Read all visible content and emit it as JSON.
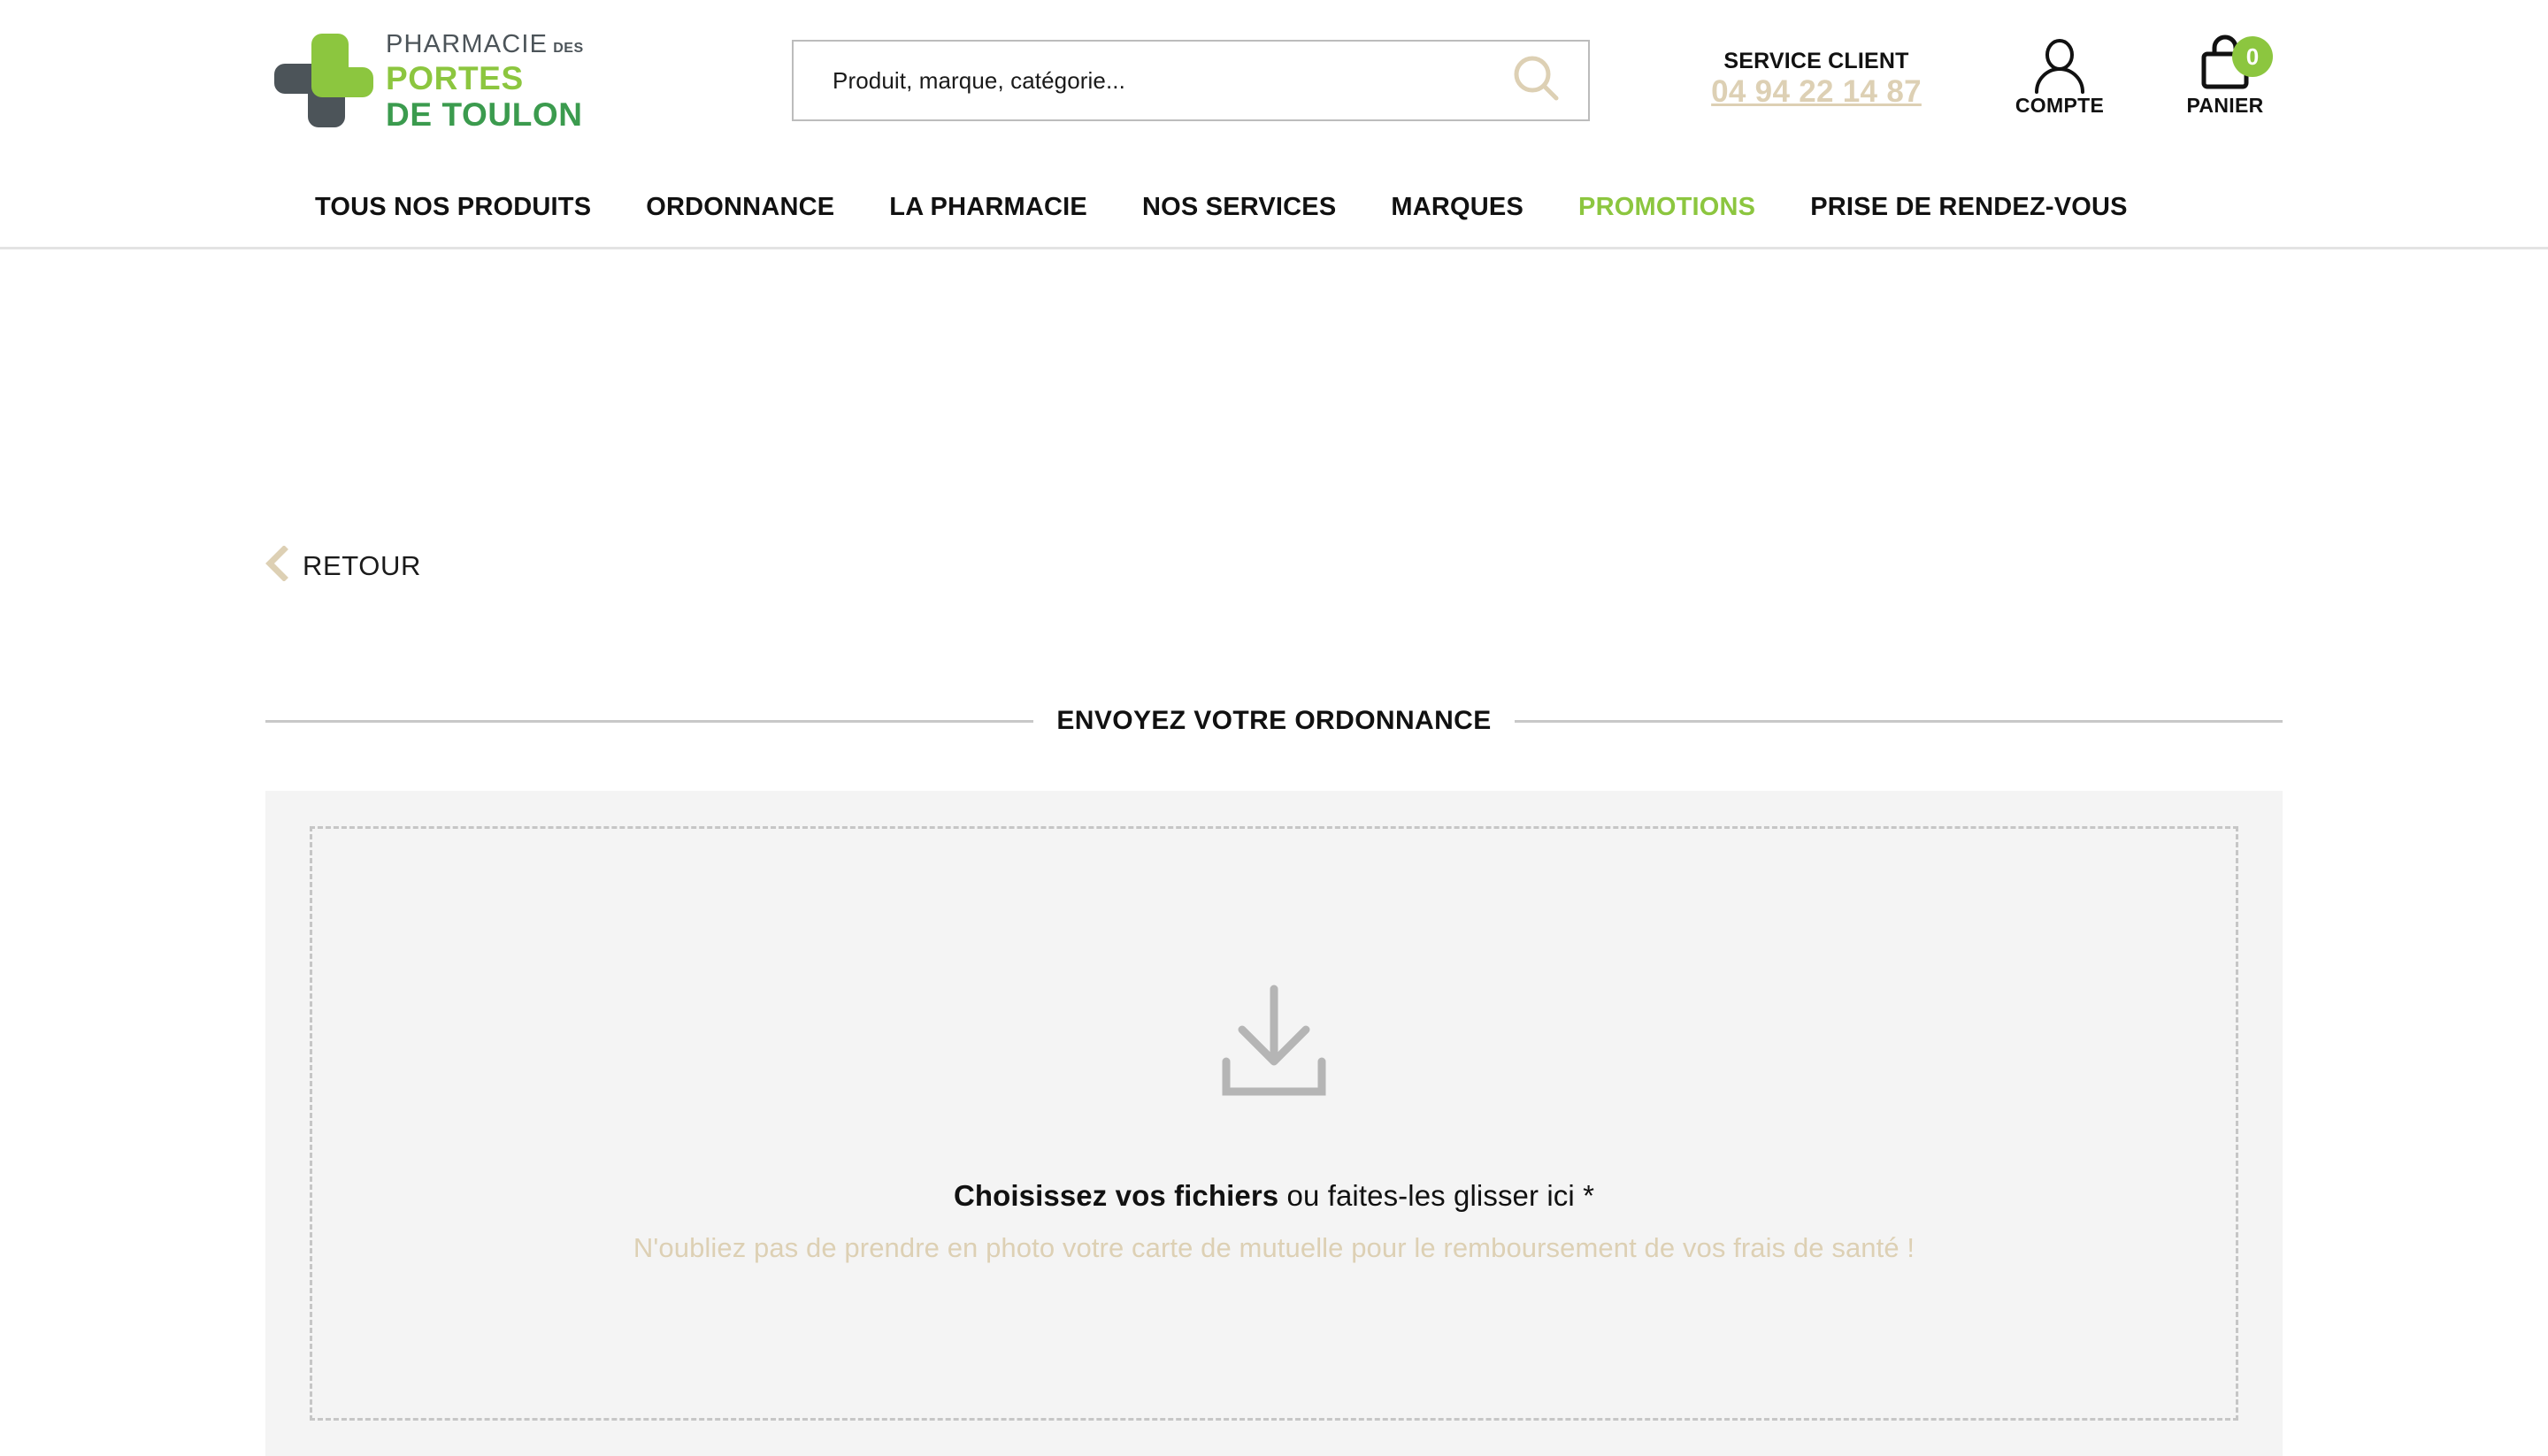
{
  "header": {
    "logo": {
      "line1": "PHARMACIE",
      "line1_suffix": "DES",
      "line2": "PORTES",
      "line3": "DE TOULON",
      "colors": {
        "dark": "#4c5459",
        "light_green": "#8cc63f",
        "dark_green": "#3b9b4e"
      }
    },
    "search": {
      "placeholder": "Produit, marque, catégorie...",
      "value": "",
      "icon": "search-icon"
    },
    "service": {
      "label": "SERVICE CLIENT",
      "phone": "04 94 22 14 87",
      "phone_color": "#ddd0b4"
    },
    "account": {
      "label": "COMPTE",
      "icon": "user-icon"
    },
    "cart": {
      "label": "PANIER",
      "icon": "shopping-bag-icon",
      "count": "0",
      "badge_color": "#8cc63f"
    }
  },
  "nav": {
    "items": [
      {
        "label": "TOUS NOS PRODUITS",
        "highlight": false
      },
      {
        "label": "ORDONNANCE",
        "highlight": false
      },
      {
        "label": "LA PHARMACIE",
        "highlight": false
      },
      {
        "label": "NOS SERVICES",
        "highlight": false
      },
      {
        "label": "MARQUES",
        "highlight": false
      },
      {
        "label": "PROMOTIONS",
        "highlight": true
      },
      {
        "label": "PRISE DE RENDEZ-VOUS",
        "highlight": false
      }
    ],
    "highlight_color": "#8cc63f"
  },
  "main": {
    "back": {
      "label": "RETOUR",
      "icon": "chevron-left-icon",
      "icon_color": "#ddd0b4"
    },
    "section_title": "ENVOYEZ VOTRE ORDONNANCE",
    "dropzone": {
      "icon": "download-icon",
      "primary_strong": "Choisissez vos fichiers",
      "primary_rest": " ou faites-les glisser ici *",
      "subtext": "N'oubliez pas de prendre en photo votre carte de mutuelle pour le remboursement de vos frais de santé !",
      "subtext_color": "#ddd0b4",
      "panel_bg": "#f4f4f4",
      "border_style": "dashed"
    }
  }
}
